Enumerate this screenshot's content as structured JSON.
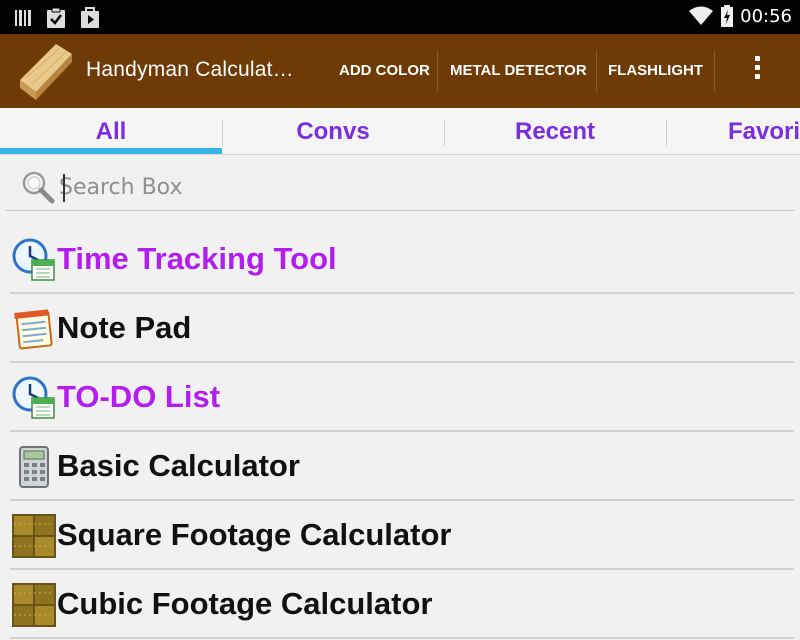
{
  "status_bar": {
    "time": "00:56",
    "left_icons": [
      "barcode-icon",
      "clipboard-check-icon",
      "play-store-icon"
    ],
    "right_icons": [
      "wifi-icon",
      "battery-icon"
    ]
  },
  "action_bar": {
    "background": "#6e3a06",
    "title": "Handyman Calculat…",
    "actions": [
      "ADD COLOR",
      "METAL DETECTOR",
      "FLASHLIGHT"
    ],
    "overflow_icon": "more-vertical-icon"
  },
  "tabs": {
    "items": [
      {
        "label": "All",
        "selected": true
      },
      {
        "label": "Convs",
        "selected": false
      },
      {
        "label": "Recent",
        "selected": false
      },
      {
        "label": "Favori",
        "selected": false
      }
    ],
    "accent": "#33b5e5",
    "text_color": "#7b2de0"
  },
  "search": {
    "placeholder": "Search Box",
    "value": "",
    "icon": "search-icon"
  },
  "list": {
    "items": [
      {
        "label": "Time Tracking Tool",
        "icon": "clock-calendar-icon",
        "color": "#b31df0"
      },
      {
        "label": "Note Pad",
        "icon": "notepad-icon",
        "color": "#111111"
      },
      {
        "label": "TO-DO List",
        "icon": "clock-calendar-icon",
        "color": "#b31df0"
      },
      {
        "label": "Basic Calculator",
        "icon": "calculator-icon",
        "color": "#111111"
      },
      {
        "label": "Square Footage Calculator",
        "icon": "floor-tile-icon",
        "color": "#111111"
      },
      {
        "label": "Cubic Footage Calculator",
        "icon": "floor-tile-icon",
        "color": "#111111"
      }
    ]
  }
}
